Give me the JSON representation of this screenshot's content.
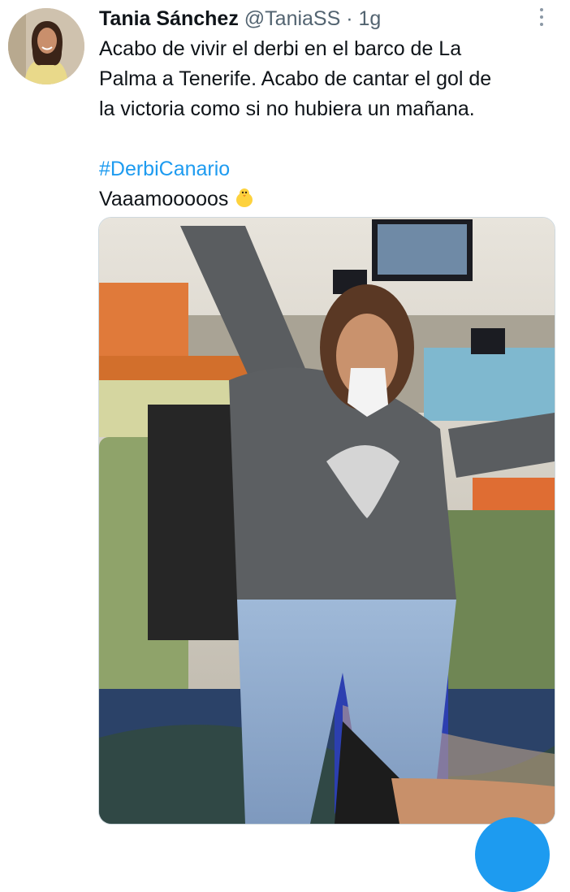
{
  "tweet": {
    "display_name": "Tania Sánchez",
    "handle": "@TaniaSS",
    "separator": "·",
    "time": "1g",
    "text_lines": [
      "Acabo de vivir el derbi en el barco de La",
      "Palma a Tenerife. Acabo de cantar el gol de",
      "la victoria como si no hubiera un mañana."
    ],
    "hashtag": "#DerbiCanario",
    "closing_text": "Vaaamooooos"
  },
  "icons": {
    "more": "more-options-icon",
    "emoji": "baby-chick-emoji",
    "compose": "compose-button"
  },
  "colors": {
    "link": "#1d9bf0",
    "secondary_text": "#536471",
    "primary_text": "#0f1419"
  }
}
